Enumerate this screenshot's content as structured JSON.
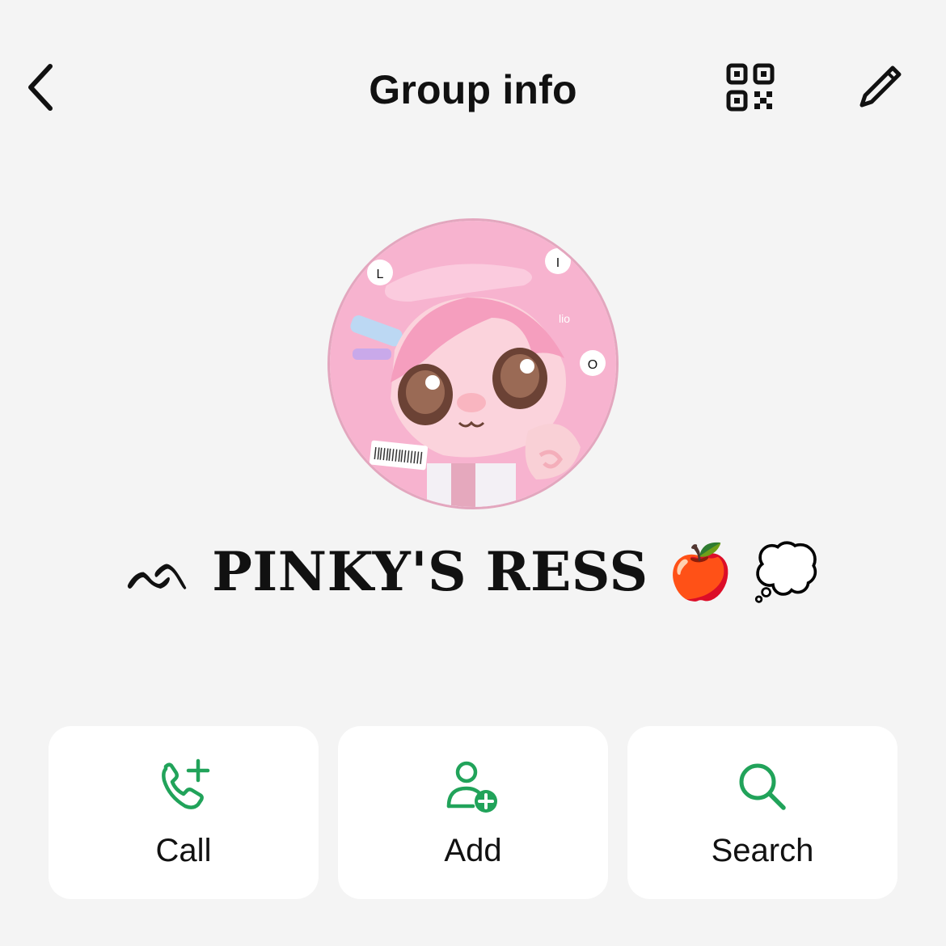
{
  "header": {
    "title": "Group info",
    "back_icon": "chevron-left-icon",
    "qr_icon": "qr-code-icon",
    "edit_icon": "pencil-icon"
  },
  "avatar": {
    "badges": [
      "L",
      "I",
      "O"
    ],
    "tag_text": "lio"
  },
  "group": {
    "prefix_glyph": "ᨒ",
    "name": "PINKY'S RESS",
    "apple_emoji": "🍎",
    "cloud_emoji": "💭"
  },
  "actions": [
    {
      "label": "Call",
      "icon": "phone-plus-icon"
    },
    {
      "label": "Add",
      "icon": "add-user-icon"
    },
    {
      "label": "Search",
      "icon": "search-icon"
    }
  ],
  "colors": {
    "background": "#f4f4f4",
    "card": "#ffffff",
    "accent_green": "#21a35a",
    "avatar_pink": "#f7b3cf"
  }
}
